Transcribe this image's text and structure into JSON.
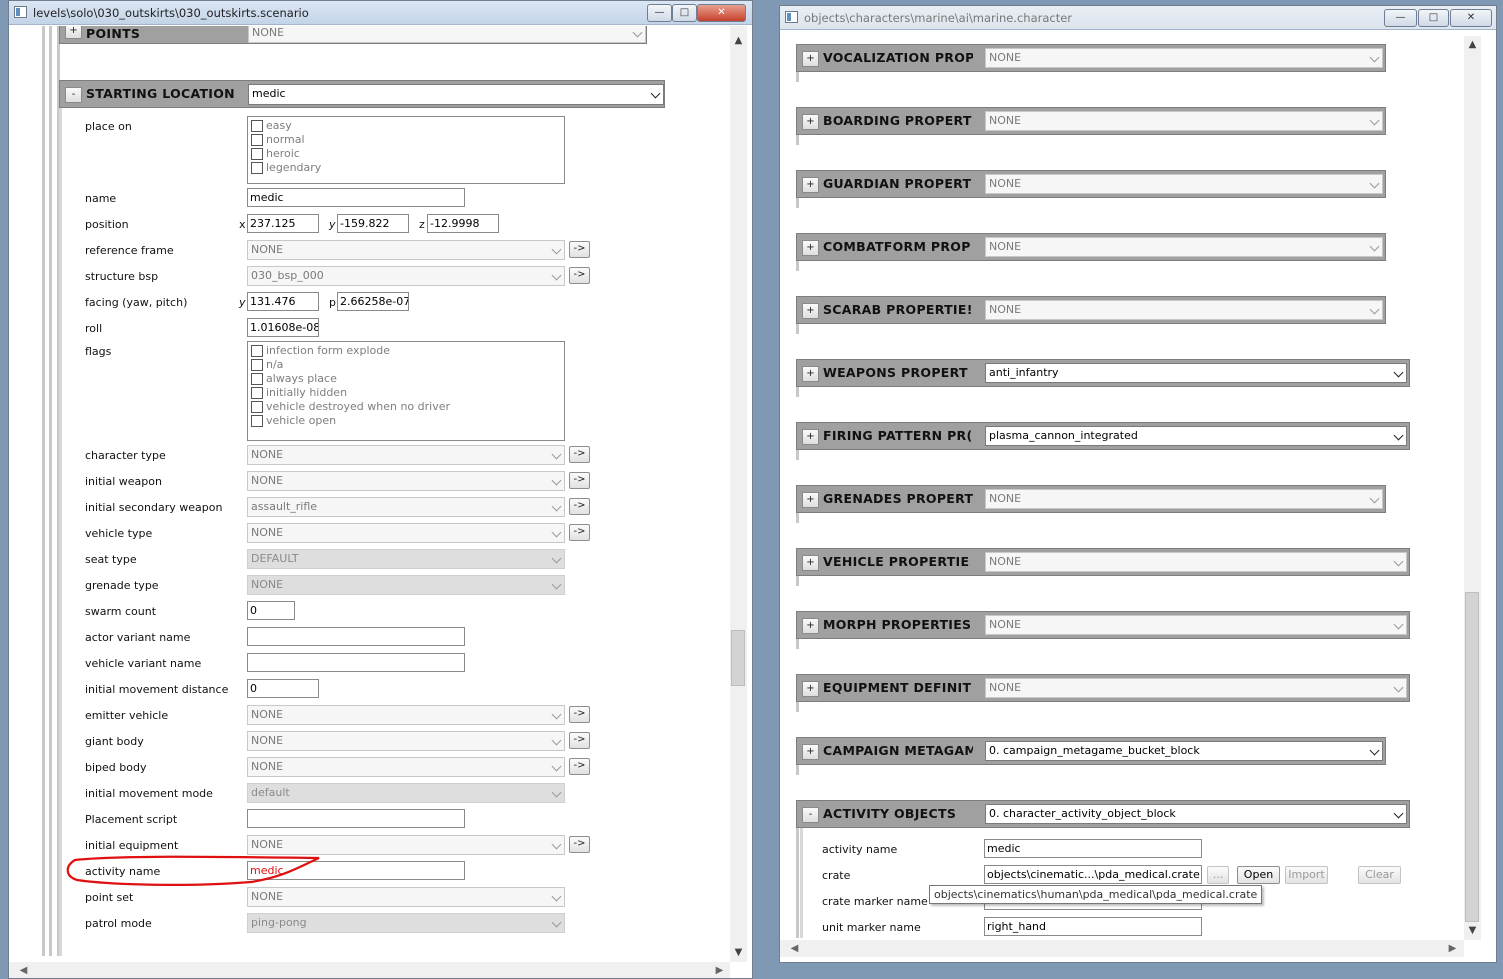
{
  "left_window": {
    "title": "levels\\solo\\030_outskirts\\030_outskirts.scenario",
    "points_block": {
      "title": "POINTS",
      "value": "NONE",
      "toggle": "+"
    },
    "starting_location": {
      "title": "STARTING LOCATION",
      "value": "medic",
      "toggle": "-",
      "place_on": {
        "label": "place on",
        "options": [
          "easy",
          "normal",
          "heroic",
          "legendary"
        ]
      },
      "name": {
        "label": "name",
        "value": "medic"
      },
      "position": {
        "label": "position",
        "x_label": "x",
        "x": "237.125",
        "y_label": "y",
        "y": "-159.822",
        "z_label": "z",
        "z": "-12.9998"
      },
      "reference_frame": {
        "label": "reference frame",
        "value": "NONE"
      },
      "structure_bsp": {
        "label": "structure bsp",
        "value": "030_bsp_000"
      },
      "facing": {
        "label": "facing (yaw, pitch)",
        "y_label": "y",
        "y": "131.476",
        "p_label": "p",
        "p": "2.66258e-07"
      },
      "roll": {
        "label": "roll",
        "value": "1.01608e-08"
      },
      "flags": {
        "label": "flags",
        "options": [
          "infection form explode",
          "n/a",
          "always place",
          "initially hidden",
          "vehicle destroyed when no driver",
          "vehicle open"
        ]
      },
      "character_type": {
        "label": "character type",
        "value": "NONE"
      },
      "initial_weapon": {
        "label": "initial weapon",
        "value": "NONE"
      },
      "initial_secondary_weapon": {
        "label": "initial secondary weapon",
        "value": "assault_rifle"
      },
      "vehicle_type": {
        "label": "vehicle type",
        "value": "NONE"
      },
      "seat_type": {
        "label": "seat type",
        "value": "DEFAULT"
      },
      "grenade_type": {
        "label": "grenade type",
        "value": "NONE"
      },
      "swarm_count": {
        "label": "swarm count",
        "value": "0"
      },
      "actor_variant_name": {
        "label": "actor variant name",
        "value": ""
      },
      "vehicle_variant_name": {
        "label": "vehicle variant name",
        "value": ""
      },
      "initial_movement_distance": {
        "label": "initial movement distance",
        "value": "0"
      },
      "emitter_vehicle": {
        "label": "emitter vehicle",
        "value": "NONE"
      },
      "giant_body": {
        "label": "giant body",
        "value": "NONE"
      },
      "biped_body": {
        "label": "biped body",
        "value": "NONE"
      },
      "initial_movement_mode": {
        "label": "initial movement mode",
        "value": "default"
      },
      "placement_script": {
        "label": "Placement script",
        "value": ""
      },
      "initial_equipment": {
        "label": "initial equipment",
        "value": "NONE"
      },
      "activity_name": {
        "label": "activity name",
        "value": "medic"
      },
      "point_set": {
        "label": "point set",
        "value": "NONE"
      },
      "patrol_mode": {
        "label": "patrol mode",
        "value": "ping-pong"
      }
    },
    "go_button_label": "->",
    "highlight_color": "#e01010"
  },
  "right_window": {
    "title": "objects\\characters\\marine\\ai\\marine.character",
    "blocks": [
      {
        "title": "VOCALIZATION PROP",
        "value": "NONE",
        "toggle": "+"
      },
      {
        "title": "BOARDING PROPERT",
        "value": "NONE",
        "toggle": "+"
      },
      {
        "title": "GUARDIAN PROPERT",
        "value": "NONE",
        "toggle": "+"
      },
      {
        "title": "COMBATFORM PROP",
        "value": "NONE",
        "toggle": "+"
      },
      {
        "title": "SCARAB PROPERTIE!",
        "value": "NONE",
        "toggle": "+"
      },
      {
        "title": "WEAPONS PROPERT",
        "value": "anti_infantry",
        "toggle": "+"
      },
      {
        "title": "FIRING PATTERN PR(",
        "value": "plasma_cannon_integrated",
        "toggle": "+"
      },
      {
        "title": "GRENADES PROPERT",
        "value": "NONE",
        "toggle": "+"
      },
      {
        "title": "VEHICLE PROPERTIE",
        "value": "NONE",
        "toggle": "+"
      },
      {
        "title": "MORPH PROPERTIES",
        "value": "NONE",
        "toggle": "+"
      },
      {
        "title": "EQUIPMENT DEFINIT",
        "value": "NONE",
        "toggle": "+"
      },
      {
        "title": "CAMPAIGN METAGAM",
        "value": "0. campaign_metagame_bucket_block",
        "toggle": "+"
      },
      {
        "title": "ACTIVITY OBJECTS",
        "value": "0. character_activity_object_block",
        "toggle": "-"
      }
    ],
    "activity_objects": {
      "activity_name": {
        "label": "activity name",
        "value": "medic"
      },
      "crate": {
        "label": "crate",
        "value": "objects\\cinematic...\\pda_medical.crate",
        "browse": "...",
        "open": "Open",
        "import": "Import",
        "clear": "Clear"
      },
      "crate_marker_name": {
        "label": "crate marker name",
        "value": ""
      },
      "unit_marker_name": {
        "label": "unit marker name",
        "value": "right_hand"
      },
      "tooltip": "objects\\cinematics\\human\\pda_medical\\pda_medical.crate"
    }
  }
}
